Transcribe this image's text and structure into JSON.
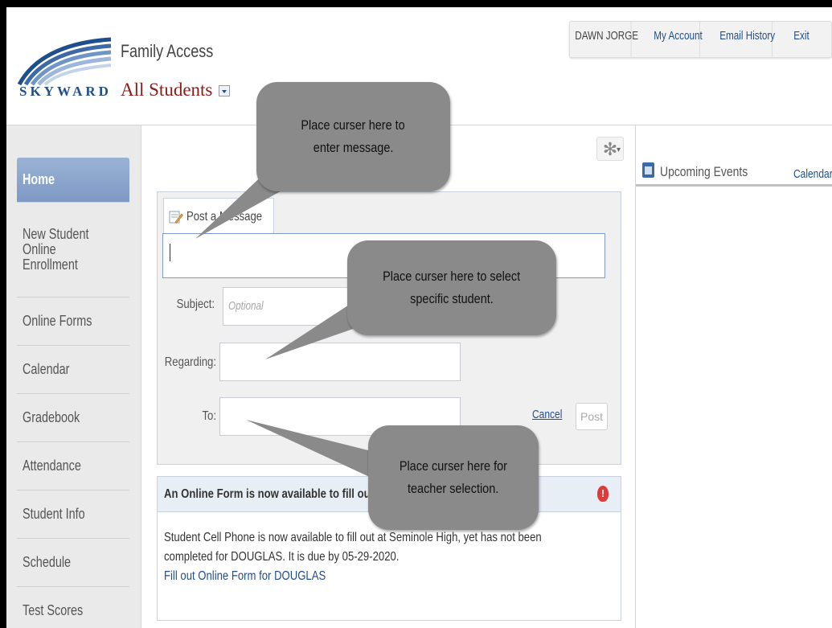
{
  "header": {
    "logo_text": "SKYWARD",
    "app_title": "Family Access",
    "student_select": "All Students",
    "user_name": "DAWN JORGE",
    "my_account": "My Account",
    "email_history": "Email History",
    "exit": "Exit"
  },
  "sidebar": {
    "items": [
      {
        "label": "Home"
      },
      {
        "label": "New Student Online Enrollment"
      },
      {
        "label": "Online Forms"
      },
      {
        "label": "Calendar"
      },
      {
        "label": "Gradebook"
      },
      {
        "label": "Attendance"
      },
      {
        "label": "Student Info"
      },
      {
        "label": "Schedule"
      },
      {
        "label": "Test Scores"
      }
    ]
  },
  "main": {
    "post_tab": "Post a Message",
    "subject_label": "Subject:",
    "subject_placeholder": "Optional",
    "regarding_label": "Regarding:",
    "to_label": "To:",
    "cancel": "Cancel",
    "post": "Post",
    "alert_title": "An Online Form is now available to fill out",
    "alert_body_line1": "Student Cell Phone is now available to fill out at Seminole High, yet has not been",
    "alert_body_line2": "completed for DOUGLAS.  It is due by 05-29-2020.",
    "alert_link": "Fill out Online Form for DOUGLAS"
  },
  "right": {
    "events_title": "Upcoming Events",
    "calendar_link": "Calendar"
  },
  "callouts": {
    "message": "Place curser here to enter message.",
    "message_line1": "Place curser here to",
    "message_line2": "enter message.",
    "student_line1": "Place curser here to select",
    "student_line2": "specific student.",
    "teacher_line1": "Place curser here for",
    "teacher_line2": "teacher selection."
  },
  "colors": {
    "brand": "#1f4e8c",
    "accent_red": "#8b1a1a",
    "nav_active": "#8aa6cc",
    "callout_gray": "#8a8a8a"
  }
}
